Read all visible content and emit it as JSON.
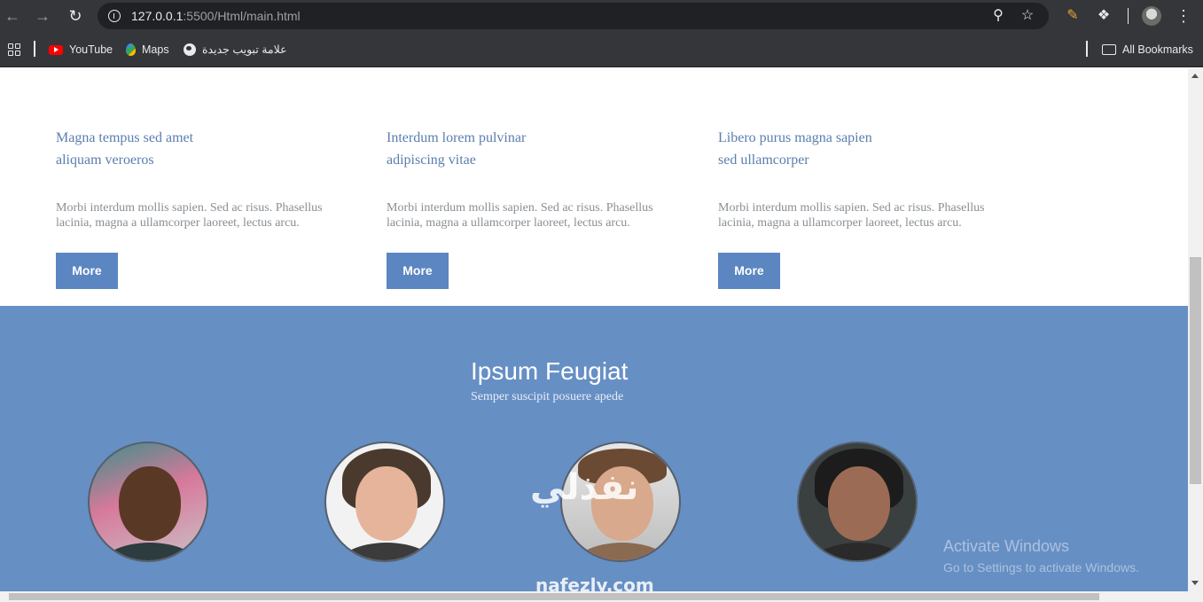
{
  "browser": {
    "url_host": "127.0.0.1",
    "url_path": ":5500/Html/main.html",
    "bookmarks": [
      {
        "label": "YouTube"
      },
      {
        "label": "Maps"
      },
      {
        "label": "علامة تبويب جديدة"
      }
    ],
    "all_bookmarks_label": "All Bookmarks"
  },
  "features": [
    {
      "title_line1": "Magna tempus sed amet",
      "title_line2": "aliquam veroeros",
      "text": "Morbi interdum mollis sapien. Sed ac risus. Phasellus lacinia, magna a ullamcorper laoreet, lectus arcu.",
      "button": "More"
    },
    {
      "title_line1": "Interdum lorem pulvinar",
      "title_line2": "adipiscing vitae",
      "text": "Morbi interdum mollis sapien. Sed ac risus. Phasellus lacinia, magna a ullamcorper laoreet, lectus arcu.",
      "button": "More"
    },
    {
      "title_line1": "Libero purus magna sapien",
      "title_line2": "sed ullamcorper",
      "text": "Morbi interdum mollis sapien. Sed ac risus. Phasellus lacinia, magna a ullamcorper laoreet, lectus arcu.",
      "button": "More"
    }
  ],
  "team_section": {
    "title": "Ipsum Feugiat",
    "subtitle": "Semper suscipit posuere apede"
  },
  "watermark": {
    "logo_text": "نفذلي",
    "url": "nafezly.com"
  },
  "windows_notice": {
    "title": "Activate Windows",
    "subtitle": "Go to Settings to activate Windows."
  },
  "colors": {
    "accent": "#5b86c1",
    "section_bg": "#668fc4",
    "heading": "#5a7eae"
  }
}
